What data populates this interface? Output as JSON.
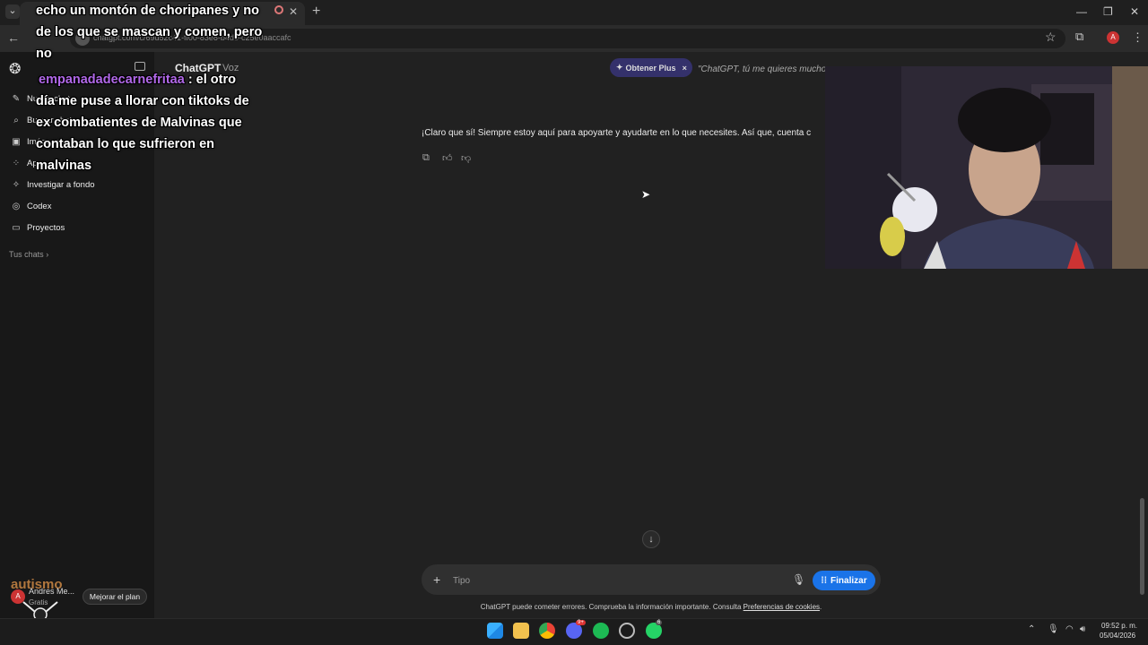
{
  "browser": {
    "tab_title": "ChatGPT",
    "url": "chatgpt.com/c/69d52c41-ff00-83e8-b4d0-c25e0aaccafc",
    "profile_initial": "A"
  },
  "sidebar": {
    "items": [
      {
        "label": "Nuevo chat",
        "icon": "compose-icon"
      },
      {
        "label": "Buscar chats",
        "icon": "search-icon"
      },
      {
        "label": "Imágenes",
        "icon": "image-icon"
      },
      {
        "label": "Apps",
        "icon": "apps-icon"
      },
      {
        "label": "Investigar a fondo",
        "icon": "research-icon"
      },
      {
        "label": "Codex",
        "icon": "codex-icon"
      },
      {
        "label": "Proyectos",
        "icon": "folder-icon"
      }
    ],
    "section_label": "Tus chats",
    "user_initial": "A",
    "user_name": "Andres Me...",
    "user_plan": "Gratis",
    "upgrade_label": "Mejorar el plan",
    "overlay_logo_text": "autismo"
  },
  "header": {
    "title": "ChatGPT",
    "mode": "Voz",
    "plus_label": "Obtener Plus",
    "transcript": "\"ChatGPT, tú me quieres mucho"
  },
  "message": {
    "text": "¡Claro que sí! Siempre estoy aquí para apoyarte y ayudarte en lo que necesites. Así que, cuenta c"
  },
  "composer": {
    "placeholder": "Tipo",
    "finalize_label": "Finalizar",
    "disclaimer": "ChatGPT puede cometer errores. Comprueba la información importante. Consulta",
    "disclaimer_link": "Preferencias de cookies",
    "disclaimer_end": "."
  },
  "overlay": {
    "line1": "echo un montón de choripanes y no",
    "line2": "de los que se mascan y comen, pero",
    "line3": "no",
    "username": "empanadadecarnefritaa",
    "line4": " : el otro",
    "line5": "día me puse a llorar con tiktoks de",
    "line6": "ex combatientes de Malvinas que",
    "line7": "contaban lo que sufrieron en",
    "line8": "malvinas"
  },
  "taskbar": {
    "time": "09:52 p. m.",
    "date": "05/04/2026",
    "discord_badge": "9+",
    "whatsapp_badge": "6"
  },
  "colors": {
    "accent": "#1a73e8",
    "plus_pill": "#34316b",
    "overlay_username": "#b168e8"
  }
}
